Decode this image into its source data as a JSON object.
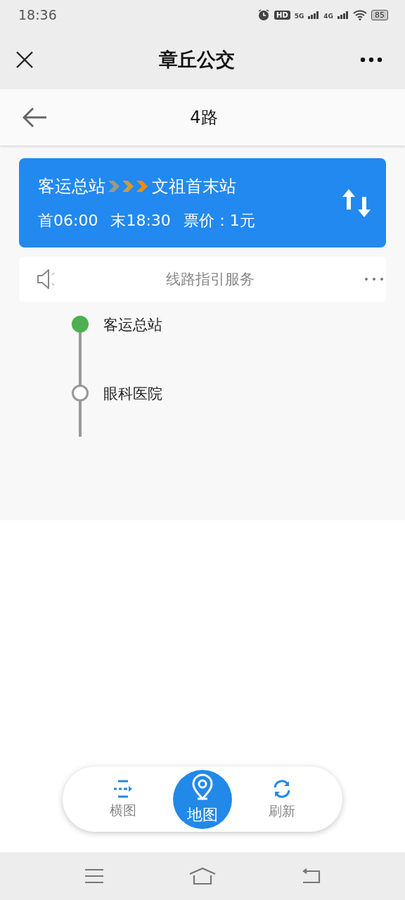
{
  "status_bar": {
    "time": "18:36",
    "hd": "HD",
    "sim1": "5G",
    "sim2": "4G",
    "battery": "85"
  },
  "header": {
    "title": "章丘公交"
  },
  "subheader": {
    "title": "4路"
  },
  "route": {
    "from": "客运总站",
    "to": "文祖首末站",
    "first": "首06:00",
    "last": "末18:30",
    "fare": "票价：1元"
  },
  "guide": {
    "label": "线路指引服务"
  },
  "stops": [
    {
      "name": "客运总站",
      "current": true
    },
    {
      "name": "眼科医院",
      "current": false
    }
  ],
  "bottom_tabs": [
    {
      "label": "横图",
      "kind": "diagram",
      "selected": false
    },
    {
      "label": "地图",
      "kind": "map",
      "selected": true
    },
    {
      "label": "刷新",
      "kind": "refresh",
      "selected": false
    }
  ]
}
